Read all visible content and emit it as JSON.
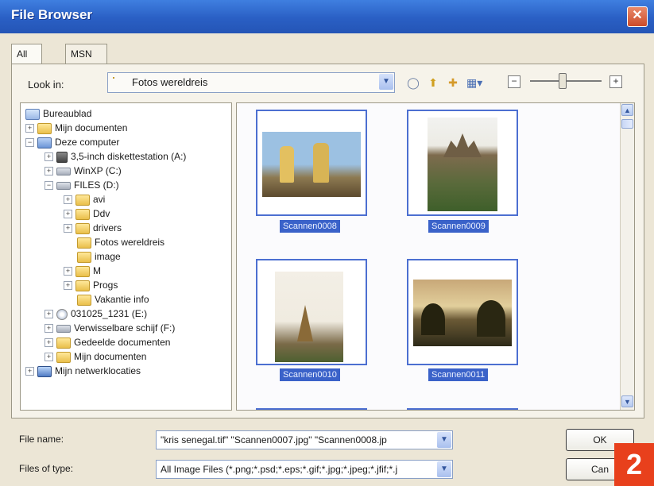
{
  "window": {
    "title": "File Browser"
  },
  "tabs": [
    {
      "label": "All Files",
      "active": true
    },
    {
      "label": "MSN Groups",
      "active": false
    }
  ],
  "look_in": {
    "label": "Look in:",
    "value": "Fotos wereldreis"
  },
  "tree": [
    {
      "label": "Bureaublad",
      "icon": "desktop-icon",
      "expander": ""
    },
    {
      "label": "Mijn documenten",
      "icon": "folder-icon",
      "expander": "+"
    },
    {
      "label": "Deze computer",
      "icon": "computer-icon",
      "expander": "−"
    },
    {
      "label": "3,5-inch diskettestation (A:)",
      "icon": "floppy-icon",
      "expander": "+"
    },
    {
      "label": "WinXP (C:)",
      "icon": "drive-icon",
      "expander": "+"
    },
    {
      "label": "FILES (D:)",
      "icon": "drive-icon",
      "expander": "−"
    },
    {
      "label": "avi",
      "icon": "folder-icon",
      "expander": "+"
    },
    {
      "label": "Ddv",
      "icon": "folder-icon",
      "expander": "+"
    },
    {
      "label": "drivers",
      "icon": "folder-icon",
      "expander": "+"
    },
    {
      "label": "Fotos wereldreis",
      "icon": "folder-icon",
      "expander": ""
    },
    {
      "label": "image",
      "icon": "folder-icon",
      "expander": ""
    },
    {
      "label": "M",
      "icon": "folder-icon",
      "expander": "+"
    },
    {
      "label": "Progs",
      "icon": "folder-icon",
      "expander": "+"
    },
    {
      "label": "Vakantie info",
      "icon": "folder-icon",
      "expander": ""
    },
    {
      "label": "031025_1231 (E:)",
      "icon": "cd-icon",
      "expander": "+"
    },
    {
      "label": "Verwisselbare schijf (F:)",
      "icon": "drive-icon",
      "expander": "+"
    },
    {
      "label": "Gedeelde documenten",
      "icon": "folder-icon",
      "expander": "+"
    },
    {
      "label": "Mijn documenten",
      "icon": "folder-icon",
      "expander": "+"
    },
    {
      "label": "Mijn netwerklocaties",
      "icon": "network-icon",
      "expander": "+"
    }
  ],
  "thumbnails": [
    {
      "label": "Scannen0008"
    },
    {
      "label": "Scannen0009"
    },
    {
      "label": "Scannen0010"
    },
    {
      "label": "Scannen0011"
    }
  ],
  "file_name": {
    "label": "File name:",
    "value": "\"kris senegal.tif\" \"Scannen0007.jpg\" \"Scannen0008.jp"
  },
  "file_type": {
    "label": "Files of type:",
    "value": "All Image Files (*.png;*.psd;*.eps;*.gif;*.jpg;*.jpeg;*.jfif;*.j"
  },
  "buttons": {
    "ok": "OK",
    "cancel": "Can"
  },
  "badge": "2",
  "colors": {
    "title_bar": "#2a5fc4",
    "selection": "#3a62c9",
    "badge": "#e8401c"
  }
}
